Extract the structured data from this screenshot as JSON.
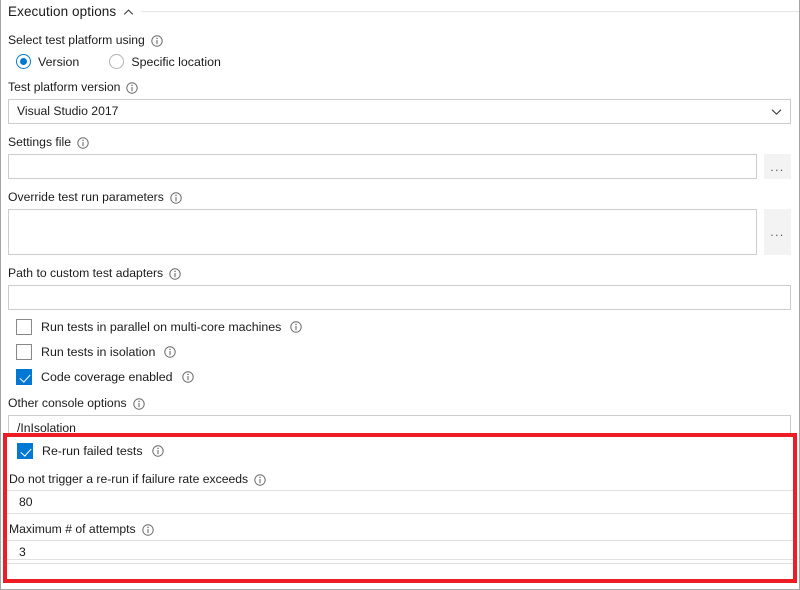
{
  "section": {
    "title": "Execution options",
    "collapse_icon": "chevron-up-icon",
    "expanded": true
  },
  "colors": {
    "accent": "#0078d4",
    "highlight_border": "#ee1c23",
    "input_border": "#cccccc",
    "text": "#1b1b1b"
  },
  "fields": {
    "select_platform": {
      "label": "Select test platform using",
      "info_icon": "info-icon",
      "options": [
        {
          "label": "Version",
          "selected": true
        },
        {
          "label": "Specific location",
          "selected": false
        }
      ]
    },
    "platform_version": {
      "label": "Test platform version",
      "info_icon": "info-icon",
      "value": "Visual Studio 2017",
      "caret_icon": "chevron-down-icon"
    },
    "settings_file": {
      "label": "Settings file",
      "info_icon": "info-icon",
      "value": "",
      "placeholder": "",
      "browse_label": "..."
    },
    "override_parameters": {
      "label": "Override test run parameters",
      "info_icon": "info-icon",
      "value": "",
      "placeholder": "",
      "browse_label": "..."
    },
    "custom_adapters": {
      "label": "Path to custom test adapters",
      "info_icon": "info-icon",
      "value": "",
      "placeholder": ""
    },
    "run_parallel": {
      "label": "Run tests in parallel on multi-core machines",
      "info_icon": "info-icon",
      "checked": false
    },
    "run_isolation": {
      "label": "Run tests in isolation",
      "info_icon": "info-icon",
      "checked": false
    },
    "code_coverage": {
      "label": "Code coverage enabled",
      "info_icon": "info-icon",
      "checked": true
    },
    "other_console_options": {
      "label": "Other console options",
      "info_icon": "info-icon",
      "value": "/InIsolation",
      "placeholder": ""
    }
  },
  "highlighted_group": {
    "rerun_failed_tests": {
      "label": "Re-run failed tests",
      "info_icon": "info-icon",
      "checked": true
    },
    "failure_rate_threshold": {
      "label": "Do not trigger a re-run if failure rate exceeds",
      "info_icon": "info-icon",
      "value": "80",
      "placeholder": ""
    },
    "max_attempts": {
      "label": "Maximum # of attempts",
      "info_icon": "info-icon",
      "value": "3",
      "placeholder": ""
    }
  }
}
